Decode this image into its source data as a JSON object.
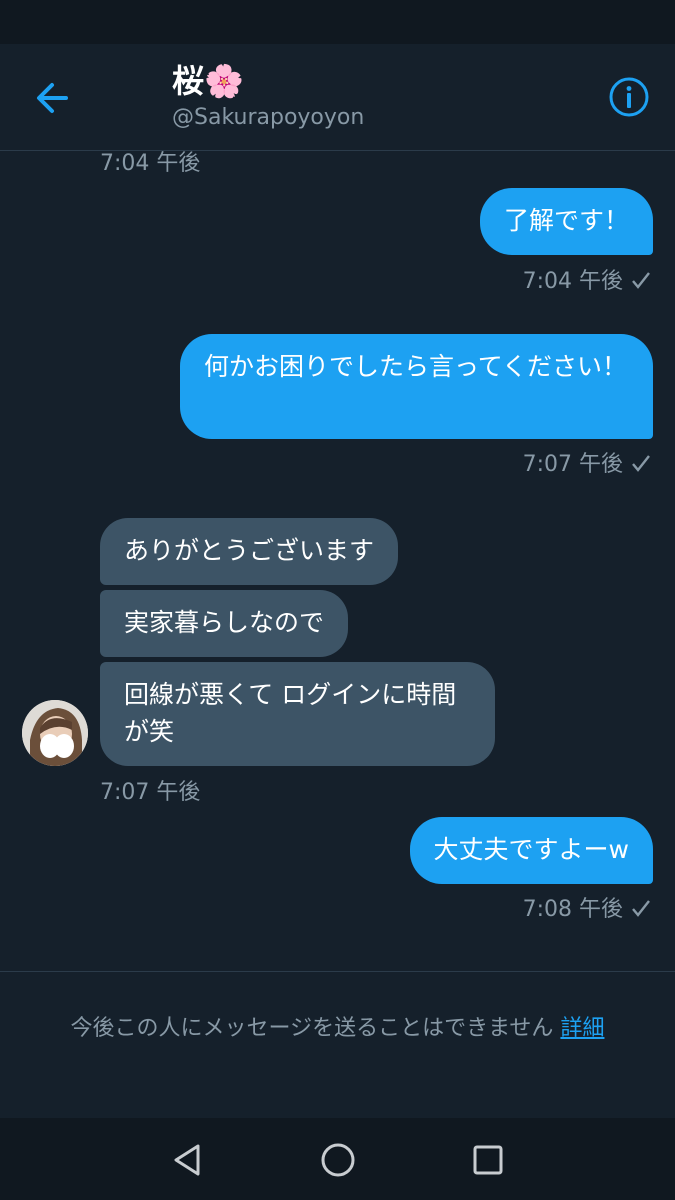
{
  "header": {
    "title": "桜🌸",
    "handle": "@Sakurapoyoyon",
    "back_icon": "arrow-left-icon",
    "info_icon": "info-icon",
    "accent": "#1da1f2"
  },
  "messages": {
    "top_timestamp": "7:04 午後",
    "m1": {
      "text": "了解です！",
      "time": "7:04 午後"
    },
    "m2": {
      "text": "何かお困りでしたら言ってください！",
      "time": "7:07 午後"
    },
    "m3": {
      "text": "ありがとうございます"
    },
    "m4": {
      "text": "実家暮らしなので"
    },
    "m5": {
      "text": "回線が悪くて ログインに時間が笑",
      "time": "7:07 午後"
    },
    "m6": {
      "text": "大丈夫ですよーw",
      "time": "7:08 午後"
    }
  },
  "footer": {
    "notice": "今後この人にメッセージを送ることはできません",
    "link": "詳細"
  },
  "navbar": {
    "back": "triangle-back-icon",
    "home": "circle-home-icon",
    "recents": "square-recents-icon"
  }
}
